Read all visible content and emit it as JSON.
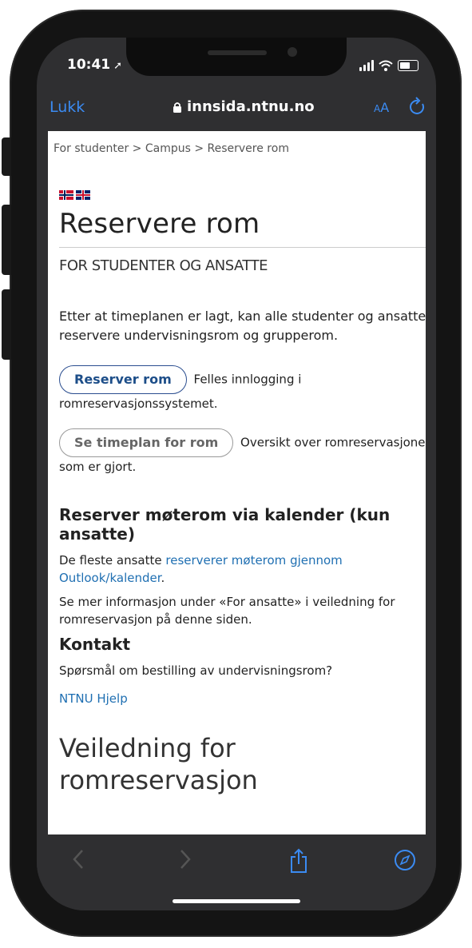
{
  "statusbar": {
    "time": "10:41"
  },
  "browser": {
    "close_label": "Lukk",
    "url": "innsida.ntnu.no",
    "text_size_label_small": "A",
    "text_size_label_big": "A"
  },
  "page": {
    "breadcrumb": "For studenter > Campus > Reservere rom",
    "title": "Reservere rom",
    "subtitle": "FOR STUDENTER OG ANSATTE",
    "intro": "Etter at timeplanen er lagt, kan alle studenter og ansatte reservere undervisningsrom og grupperom.",
    "reserve_button": "Reserver rom",
    "reserve_text": "Felles innlogging i romreservasjonssystemet.",
    "schedule_button": "Se timeplan for rom",
    "schedule_text": "Oversikt over romreservasjoner som er gjort.",
    "section_meeting": "Reserver møterom via kalender (kun ansatte)",
    "meeting_para_prefix": "De fleste ansatte ",
    "meeting_link": "reserverer møterom gjennom Outlook/kalender",
    "meeting_para_suffix": ".",
    "more_info": "Se mer informasjon under «For ansatte» i veiledning for romreservasjon på denne siden.",
    "section_contact": "Kontakt",
    "contact_question": "Spørsmål om bestilling av undervisningsrom?",
    "contact_link": "NTNU Hjelp",
    "guide_heading": "Veiledning for romreservasjon"
  },
  "colors": {
    "accent": "#3b8bf2",
    "link": "#1f6fb2",
    "button_border": "#2a4d8f"
  }
}
